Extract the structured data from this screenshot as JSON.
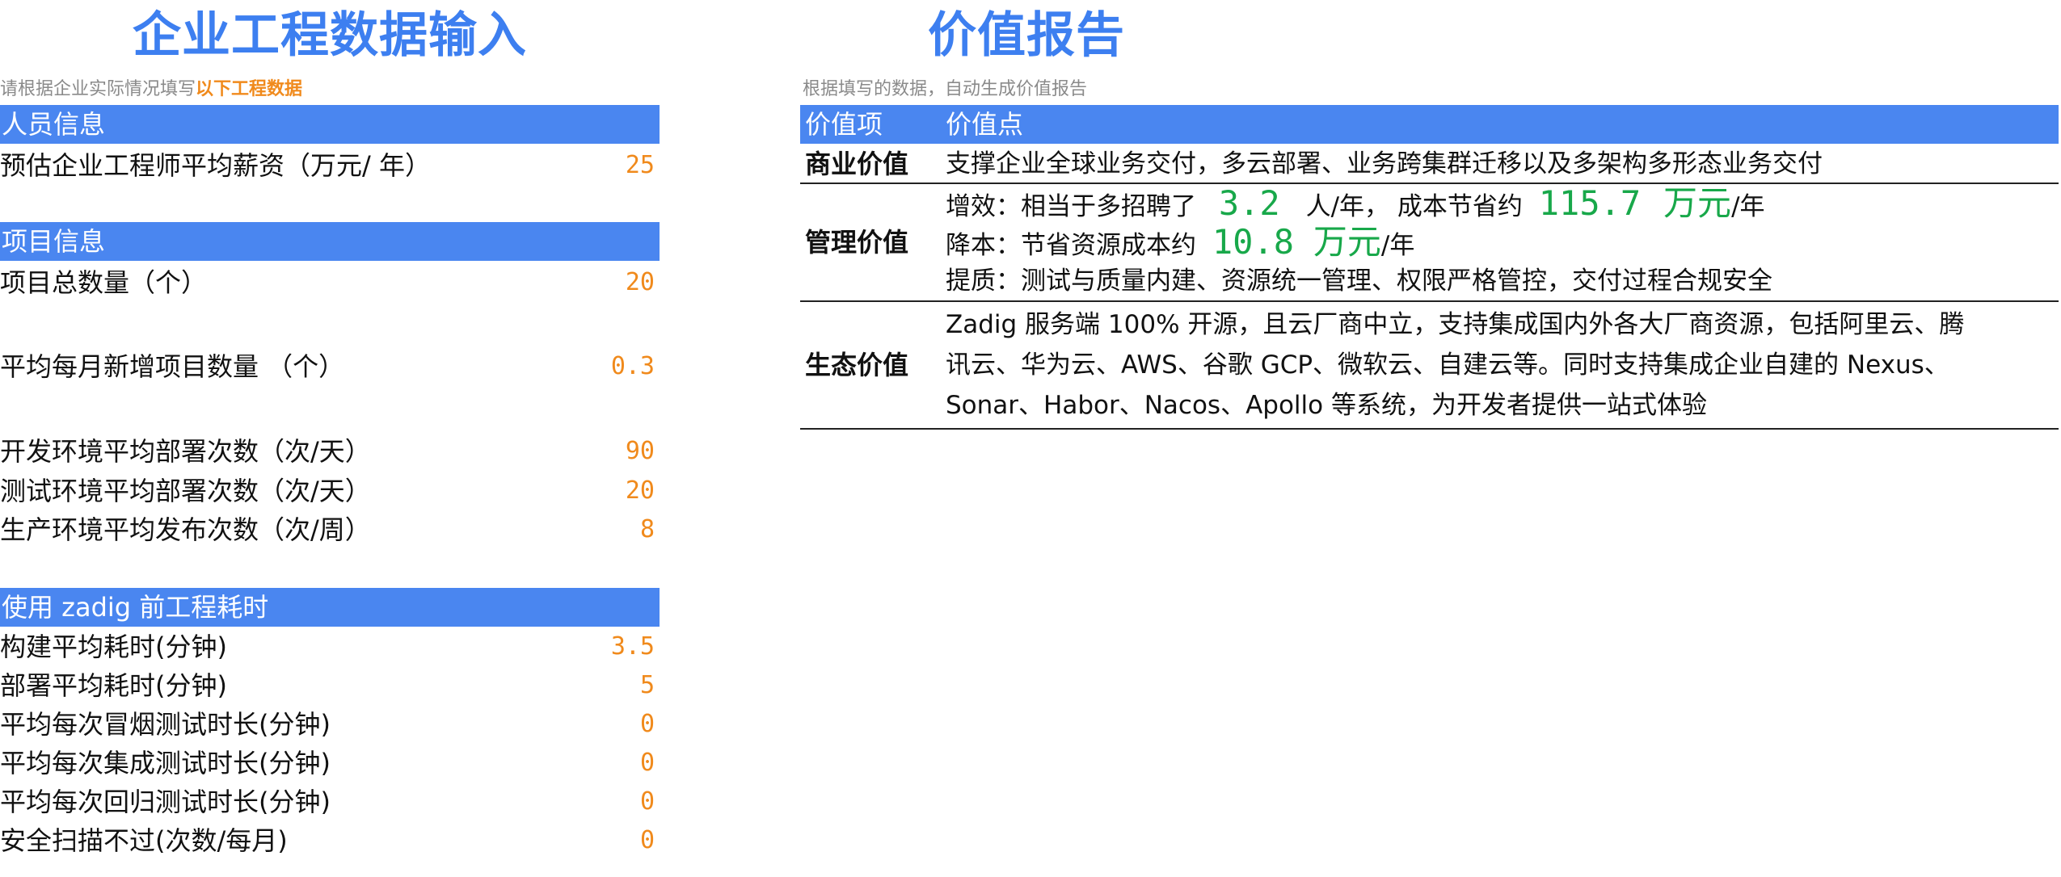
{
  "left": {
    "title": "企业工程数据输入",
    "subtitle_prefix": "请根据企业实际情况填写",
    "subtitle_highlight": "以下工程数据",
    "sections": [
      {
        "header": "人员信息",
        "rows": [
          {
            "label": "预估企业工程师平均薪资（万元/ 年）",
            "value": "25"
          }
        ]
      },
      {
        "header": "项目信息",
        "rows": [
          {
            "label": "项目总数量（个）",
            "value": "20"
          },
          {
            "label": "平均每月新增项目数量 （个）",
            "value": "0.3"
          },
          {
            "label": "开发环境平均部署次数（次/天）",
            "value": "90"
          },
          {
            "label": "测试环境平均部署次数（次/天）",
            "value": "20"
          },
          {
            "label": "生产环境平均发布次数（次/周）",
            "value": "8"
          }
        ]
      },
      {
        "header": "使用 zadig 前工程耗时",
        "rows": [
          {
            "label": "构建平均耗时(分钟)",
            "value": "3.5"
          },
          {
            "label": "部署平均耗时(分钟)",
            "value": "5"
          },
          {
            "label": "平均每次冒烟测试时长(分钟)",
            "value": "0"
          },
          {
            "label": "平均每次集成测试时长(分钟)",
            "value": "0"
          },
          {
            "label": "平均每次回归测试时长(分钟)",
            "value": "0"
          },
          {
            "label": "安全扫描不过(次数/每月)",
            "value": "0"
          }
        ]
      }
    ]
  },
  "right": {
    "title": "价值报告",
    "subtitle": "根据填写的数据，自动生成价值报告",
    "columns": [
      "价值项",
      "价值点"
    ],
    "business": {
      "key": "商业价值",
      "text": "支撑企业全球业务交付，多云部署、业务跨集群迁移以及多架构多形态业务交付"
    },
    "management": {
      "key": "管理价值",
      "efficiency_prefix": "增效：相当于多招聘了",
      "efficiency_value": "3.2",
      "efficiency_mid": "人/年，  成本节省约",
      "saving_value": "115.7",
      "saving_unit": "万元",
      "per_year": "/年",
      "cost_prefix": "降本：节省资源成本约",
      "cost_value": "10.8",
      "cost_unit": "万元",
      "quality": "提质：测试与质量内建、资源统一管理、权限严格管控，交付过程合规安全"
    },
    "ecosystem": {
      "key": "生态价值",
      "lines": [
        "Zadig 服务端 100% 开源，且云厂商中立，支持集成国内外各大厂商资源，包括阿里云、腾",
        "讯云、华为云、AWS、谷歌 GCP、微软云、自建云等。同时支持集成企业自建的 Nexus、",
        "Sonar、Habor、Nacos、Apollo 等系统，为开发者提供一站式体验"
      ]
    }
  },
  "colors": {
    "accent": "#4a86f0",
    "title": "#3d7ff0",
    "value": "#f08a1c",
    "green": "#18a84a"
  }
}
